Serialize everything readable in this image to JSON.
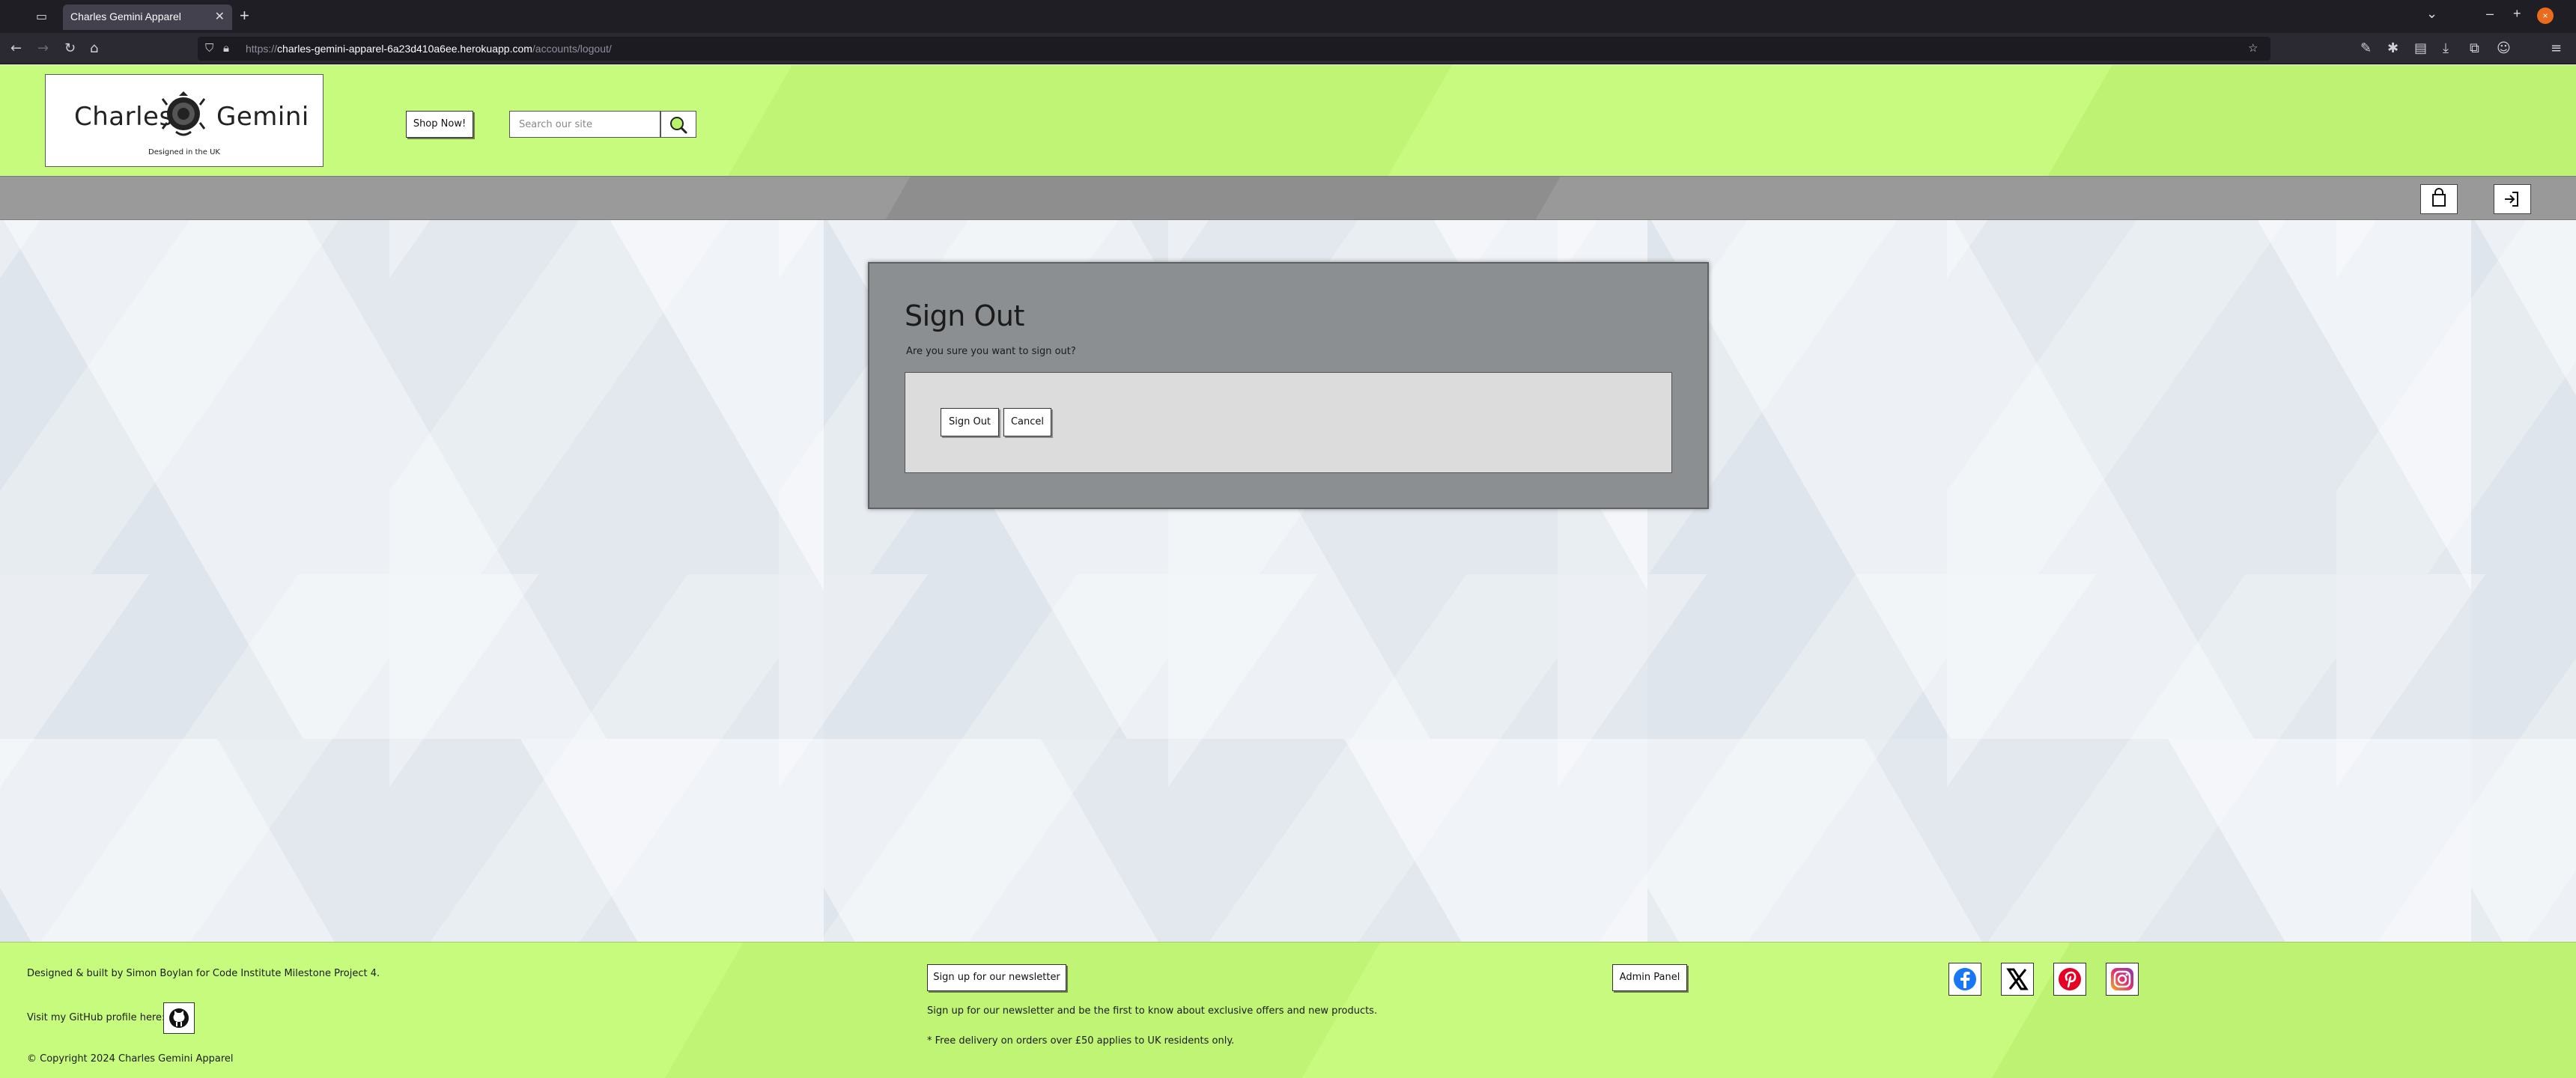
{
  "browser": {
    "tab_title": "Charles Gemini Apparel",
    "url_proto": "https://",
    "url_host": "charles-gemini-apparel-6a23d410a6ee.herokuapp.com",
    "url_path": "/accounts/logout/"
  },
  "header": {
    "logo_left": "Charles",
    "logo_right": "Gemini",
    "tagline": "Designed in the UK",
    "shop_button": "Shop Now!",
    "search_placeholder": "Search our site"
  },
  "toolbar": {
    "icons": [
      "shopping-bag-icon",
      "logout-icon"
    ]
  },
  "signout": {
    "title": "Sign Out",
    "prompt": "Are you sure you want to sign out?",
    "signout_button": "Sign Out",
    "cancel_button": "Cancel"
  },
  "footer": {
    "credits": "Designed & built by Simon Boylan for Code Institute Milestone Project 4.",
    "github_text": "Visit my GitHub profile here:",
    "copyright": "© Copyright 2024 Charles Gemini Apparel",
    "newsletter_button": "Sign up for our newsletter",
    "newsletter_text": "Sign up for our newsletter and be the first to know about exclusive offers and new products.",
    "delivery_text": "* Free delivery on orders over £50 applies to UK residents only.",
    "admin_button": "Admin Panel",
    "socials": [
      "facebook-icon",
      "x-icon",
      "pinterest-icon",
      "instagram-icon"
    ]
  },
  "colors": {
    "header_green": "#c7fb7d",
    "toolbar_grey": "#999999",
    "card_grey": "#8c8f91",
    "facebook": "#1877f2",
    "pinterest": "#e60023",
    "instagram": "#c13584"
  }
}
